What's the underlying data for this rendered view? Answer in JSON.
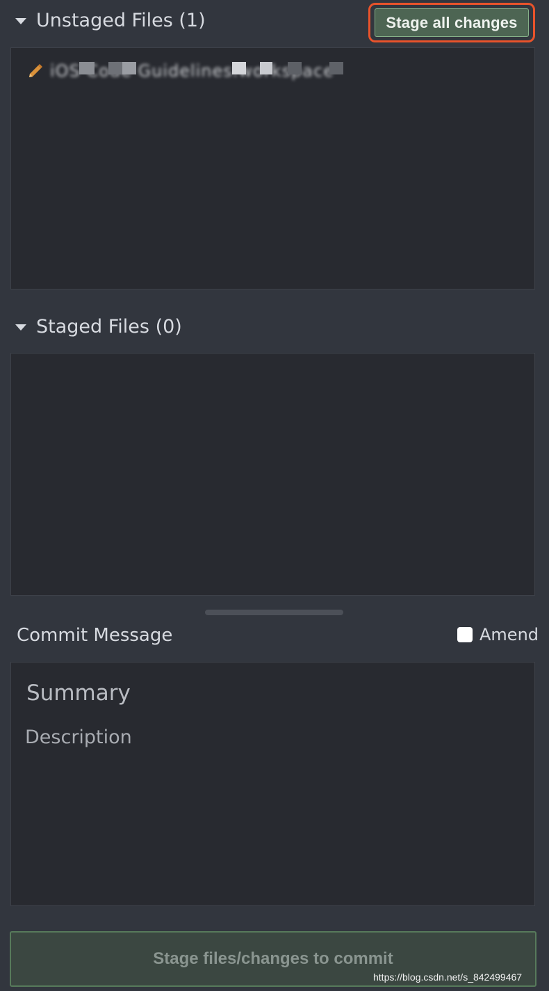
{
  "unstaged": {
    "title": "Unstaged Files (1)",
    "stage_all_label": "Stage all changes",
    "files": [
      {
        "icon": "pencil-icon",
        "name": "iOS Code Guidelines.workspace"
      }
    ]
  },
  "staged": {
    "title": "Staged Files (0)"
  },
  "commit": {
    "label": "Commit Message",
    "amend_label": "Amend",
    "amend_checked": false,
    "summary_placeholder": "Summary",
    "description_placeholder": "Description",
    "submit_label": "Stage files/changes to commit"
  },
  "watermark": "https://blog.csdn.net/s_842499467",
  "colors": {
    "accent_highlight": "#e8532b",
    "button_green": "#4d6553",
    "modified_icon": "#d9913a"
  }
}
